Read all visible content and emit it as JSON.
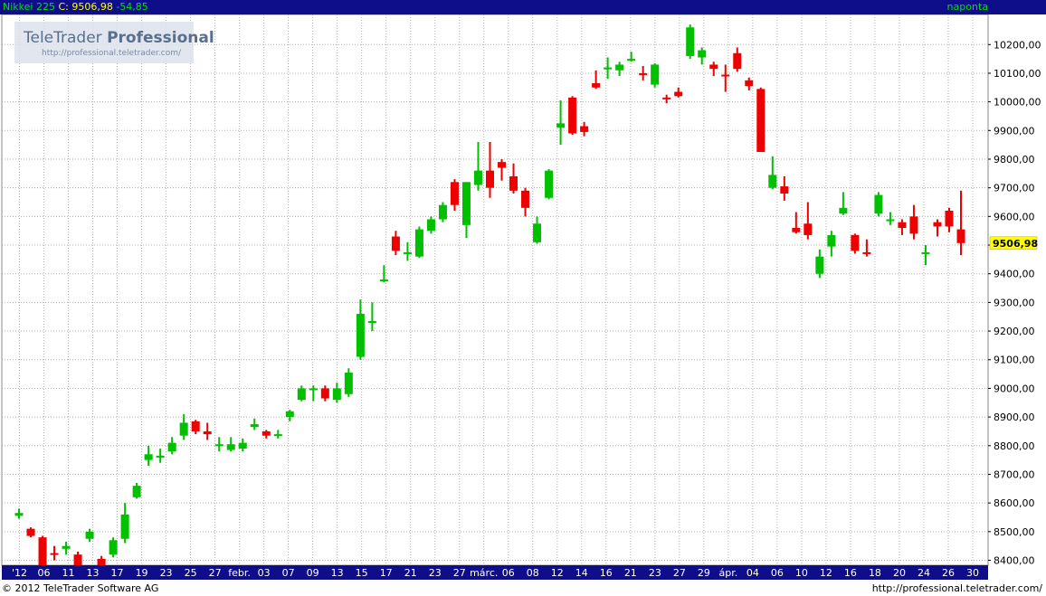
{
  "header": {
    "instrument": "Nikkei 225",
    "close_label": "C:",
    "close_value": "9506,98",
    "change": "-54,85",
    "period": "naponta"
  },
  "logo": {
    "brand_light": "TeleTrader",
    "brand_bold": "Professional",
    "url": "http://professional.teletrader.com/"
  },
  "footer": {
    "copyright": "© 2012 TeleTrader Software AG",
    "url": "http://professional.teletrader.com/"
  },
  "colors": {
    "up": "#00c000",
    "down": "#ee0000",
    "header_bg": "#0e0e8a",
    "price_marker": "#ffff00"
  },
  "chart_data": {
    "type": "candlestick",
    "ylim": [
      8350,
      10260
    ],
    "yticks": [
      8400,
      8500,
      8600,
      8700,
      8800,
      8900,
      9000,
      9100,
      9200,
      9300,
      9400,
      9500,
      9600,
      9700,
      9800,
      9900,
      10000,
      10100,
      10200
    ],
    "ytick_labels": [
      "8400,00",
      "8500,00",
      "8600,00",
      "8700,00",
      "8800,00",
      "8900,00",
      "9000,00",
      "9100,00",
      "9200,00",
      "9300,00",
      "9400,00",
      "9500,00",
      "9600,00",
      "9700,00",
      "9800,00",
      "9900,00",
      "10000,00",
      "10100,00",
      "10200,00"
    ],
    "xtick_labels": [
      "'12",
      "06",
      "11",
      "13",
      "17",
      "19",
      "23",
      "25",
      "27",
      "febr.",
      "03",
      "07",
      "09",
      "13",
      "15",
      "17",
      "21",
      "23",
      "27",
      "márc.",
      "06",
      "08",
      "12",
      "14",
      "16",
      "21",
      "23",
      "27",
      "29",
      "ápr.",
      "04",
      "06",
      "10",
      "12",
      "16",
      "18",
      "20",
      "24",
      "26",
      "30"
    ],
    "last_price_label": "9506,98",
    "last_price": 9506.98,
    "grid": true,
    "candles": [
      {
        "o": 8555,
        "h": 8580,
        "l": 8545,
        "c": 8565
      },
      {
        "o": 8510,
        "h": 8515,
        "l": 8480,
        "c": 8485
      },
      {
        "o": 8480,
        "h": 8485,
        "l": 8355,
        "c": 8380
      },
      {
        "o": 8425,
        "h": 8450,
        "l": 8400,
        "c": 8420
      },
      {
        "o": 8440,
        "h": 8465,
        "l": 8420,
        "c": 8450
      },
      {
        "o": 8420,
        "h": 8430,
        "l": 8365,
        "c": 8380
      },
      {
        "o": 8475,
        "h": 8510,
        "l": 8465,
        "c": 8500
      },
      {
        "o": 8405,
        "h": 8415,
        "l": 8365,
        "c": 8380
      },
      {
        "o": 8420,
        "h": 8480,
        "l": 8410,
        "c": 8470
      },
      {
        "o": 8475,
        "h": 8600,
        "l": 8460,
        "c": 8560
      },
      {
        "o": 8620,
        "h": 8670,
        "l": 8615,
        "c": 8660
      },
      {
        "o": 8750,
        "h": 8800,
        "l": 8730,
        "c": 8770
      },
      {
        "o": 8765,
        "h": 8790,
        "l": 8740,
        "c": 8765
      },
      {
        "o": 8780,
        "h": 8830,
        "l": 8770,
        "c": 8810
      },
      {
        "o": 8835,
        "h": 8910,
        "l": 8820,
        "c": 8880
      },
      {
        "o": 8885,
        "h": 8890,
        "l": 8840,
        "c": 8850
      },
      {
        "o": 8850,
        "h": 8880,
        "l": 8820,
        "c": 8840
      },
      {
        "o": 8800,
        "h": 8830,
        "l": 8780,
        "c": 8805
      },
      {
        "o": 8785,
        "h": 8830,
        "l": 8780,
        "c": 8805
      },
      {
        "o": 8790,
        "h": 8825,
        "l": 8780,
        "c": 8810
      },
      {
        "o": 8865,
        "h": 8895,
        "l": 8855,
        "c": 8875
      },
      {
        "o": 8850,
        "h": 8855,
        "l": 8825,
        "c": 8835
      },
      {
        "o": 8840,
        "h": 8855,
        "l": 8825,
        "c": 8840
      },
      {
        "o": 8900,
        "h": 8925,
        "l": 8885,
        "c": 8920
      },
      {
        "o": 8960,
        "h": 9010,
        "l": 8955,
        "c": 9000
      },
      {
        "o": 8995,
        "h": 9010,
        "l": 8955,
        "c": 9000
      },
      {
        "o": 9000,
        "h": 9010,
        "l": 8955,
        "c": 8965
      },
      {
        "o": 8960,
        "h": 9020,
        "l": 8950,
        "c": 9000
      },
      {
        "o": 8980,
        "h": 9070,
        "l": 8970,
        "c": 9055
      },
      {
        "o": 9110,
        "h": 9310,
        "l": 9100,
        "c": 9260
      },
      {
        "o": 9230,
        "h": 9300,
        "l": 9200,
        "c": 9235
      },
      {
        "o": 9375,
        "h": 9430,
        "l": 9370,
        "c": 9380
      },
      {
        "o": 9530,
        "h": 9550,
        "l": 9465,
        "c": 9480
      },
      {
        "o": 9475,
        "h": 9510,
        "l": 9445,
        "c": 9475
      },
      {
        "o": 9460,
        "h": 9565,
        "l": 9455,
        "c": 9555
      },
      {
        "o": 9550,
        "h": 9600,
        "l": 9540,
        "c": 9590
      },
      {
        "o": 9590,
        "h": 9650,
        "l": 9580,
        "c": 9640
      },
      {
        "o": 9720,
        "h": 9730,
        "l": 9620,
        "c": 9640
      },
      {
        "o": 9570,
        "h": 9720,
        "l": 9525,
        "c": 9720
      },
      {
        "o": 9710,
        "h": 9860,
        "l": 9690,
        "c": 9760
      },
      {
        "o": 9760,
        "h": 9860,
        "l": 9665,
        "c": 9700
      },
      {
        "o": 9790,
        "h": 9800,
        "l": 9725,
        "c": 9770
      },
      {
        "o": 9740,
        "h": 9785,
        "l": 9680,
        "c": 9690
      },
      {
        "o": 9690,
        "h": 9700,
        "l": 9600,
        "c": 9630
      },
      {
        "o": 9510,
        "h": 9600,
        "l": 9505,
        "c": 9575
      },
      {
        "o": 9665,
        "h": 9765,
        "l": 9660,
        "c": 9760
      },
      {
        "o": 9910,
        "h": 10005,
        "l": 9850,
        "c": 9925
      },
      {
        "o": 10015,
        "h": 10020,
        "l": 9885,
        "c": 9890
      },
      {
        "o": 9915,
        "h": 9930,
        "l": 9880,
        "c": 9895
      },
      {
        "o": 10065,
        "h": 10110,
        "l": 10045,
        "c": 10050
      },
      {
        "o": 10115,
        "h": 10155,
        "l": 10080,
        "c": 10120
      },
      {
        "o": 10110,
        "h": 10140,
        "l": 10090,
        "c": 10130
      },
      {
        "o": 10150,
        "h": 10175,
        "l": 10140,
        "c": 10150
      },
      {
        "o": 10100,
        "h": 10125,
        "l": 10075,
        "c": 10095
      },
      {
        "o": 10060,
        "h": 10135,
        "l": 10050,
        "c": 10130
      },
      {
        "o": 10015,
        "h": 10025,
        "l": 9995,
        "c": 10010
      },
      {
        "o": 10035,
        "h": 10050,
        "l": 10015,
        "c": 10020
      },
      {
        "o": 10160,
        "h": 10270,
        "l": 10150,
        "c": 10260
      },
      {
        "o": 10155,
        "h": 10190,
        "l": 10130,
        "c": 10180
      },
      {
        "o": 10130,
        "h": 10140,
        "l": 10090,
        "c": 10115
      },
      {
        "o": 10095,
        "h": 10130,
        "l": 10035,
        "c": 10090
      },
      {
        "o": 10170,
        "h": 10190,
        "l": 10105,
        "c": 10115
      },
      {
        "o": 10075,
        "h": 10085,
        "l": 10040,
        "c": 10055
      },
      {
        "o": 10045,
        "h": 10050,
        "l": 9825,
        "c": 9825
      },
      {
        "o": 9700,
        "h": 9810,
        "l": 9695,
        "c": 9745
      },
      {
        "o": 9705,
        "h": 9740,
        "l": 9655,
        "c": 9680
      },
      {
        "o": 9560,
        "h": 9615,
        "l": 9540,
        "c": 9545
      },
      {
        "o": 9575,
        "h": 9650,
        "l": 9520,
        "c": 9535
      },
      {
        "o": 9400,
        "h": 9485,
        "l": 9385,
        "c": 9460
      },
      {
        "o": 9495,
        "h": 9550,
        "l": 9460,
        "c": 9535
      },
      {
        "o": 9610,
        "h": 9685,
        "l": 9605,
        "c": 9630
      },
      {
        "o": 9535,
        "h": 9540,
        "l": 9470,
        "c": 9480
      },
      {
        "o": 9475,
        "h": 9520,
        "l": 9460,
        "c": 9470
      },
      {
        "o": 9610,
        "h": 9685,
        "l": 9600,
        "c": 9675
      },
      {
        "o": 9585,
        "h": 9615,
        "l": 9570,
        "c": 9590
      },
      {
        "o": 9580,
        "h": 9590,
        "l": 9535,
        "c": 9560
      },
      {
        "o": 9600,
        "h": 9640,
        "l": 9520,
        "c": 9540
      },
      {
        "o": 9475,
        "h": 9500,
        "l": 9430,
        "c": 9475
      },
      {
        "o": 9580,
        "h": 9590,
        "l": 9530,
        "c": 9565
      },
      {
        "o": 9620,
        "h": 9630,
        "l": 9545,
        "c": 9565
      },
      {
        "o": 9555,
        "h": 9690,
        "l": 9465,
        "c": 9507
      }
    ]
  }
}
